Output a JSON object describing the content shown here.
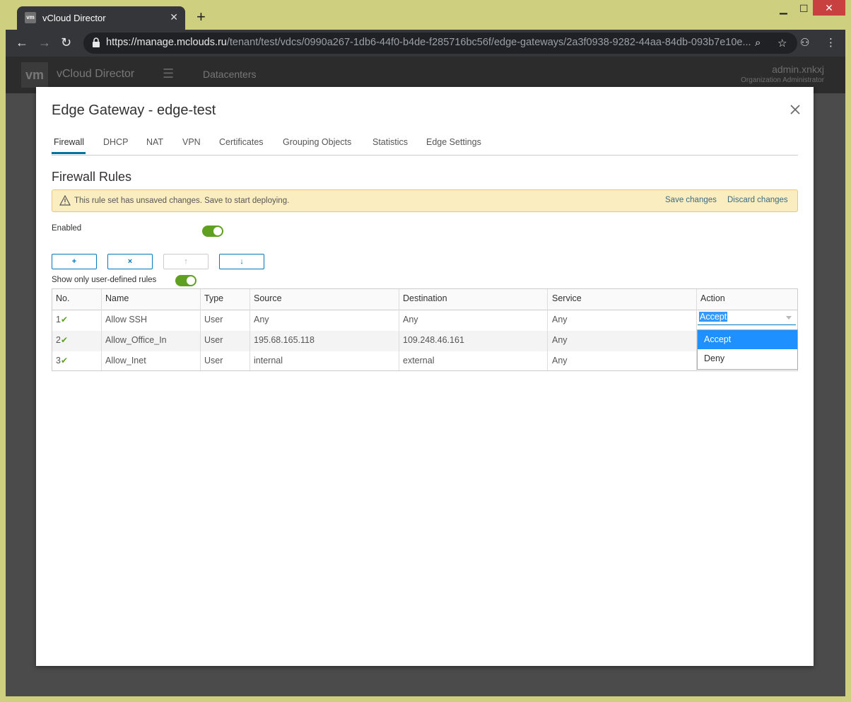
{
  "browser": {
    "tab_title": "vCloud Director",
    "favicon_text": "vm",
    "url_host": "https://manage.mclouds.ru",
    "url_path": "/tenant/test/vdcs/0990a267-1db6-44f0-b4de-f285716bc56f/edge-gateways/2a3f0938-9282-44aa-84db-093b7e10e..."
  },
  "app": {
    "logo": "vm",
    "name": "vCloud Director",
    "nav": "Datacenters",
    "user": "admin.xnkxj",
    "role": "Organization Administrator"
  },
  "modal": {
    "title": "Edge Gateway - edge-test",
    "tabs": [
      "Firewall",
      "DHCP",
      "NAT",
      "VPN",
      "Certificates",
      "Grouping Objects",
      "Statistics",
      "Edge Settings"
    ],
    "active_tab": "Firewall",
    "section_title": "Firewall Rules",
    "alert": {
      "text": "This rule set has unsaved changes. Save to start deploying.",
      "save": "Save changes",
      "discard": "Discard changes"
    },
    "enabled_label": "Enabled",
    "enabled": true,
    "buttons": {
      "add": "+",
      "remove": "×",
      "up": "↑",
      "down": "↓"
    },
    "user_defined_label": "Show only user-defined rules",
    "user_defined": true,
    "columns": [
      "No.",
      "Name",
      "Type",
      "Source",
      "Destination",
      "Service",
      "Action"
    ],
    "rows": [
      {
        "no": "1",
        "name": "Allow SSH",
        "type": "User",
        "source": "Any",
        "destination": "Any",
        "service": "Any",
        "action": "Accept"
      },
      {
        "no": "2",
        "name": "Allow_Office_In",
        "type": "User",
        "source": "195.68.165.118",
        "destination": "109.248.46.161",
        "service": "Any",
        "action": ""
      },
      {
        "no": "3",
        "name": "Allow_Inet",
        "type": "User",
        "source": "internal",
        "destination": "external",
        "service": "Any",
        "action": ""
      }
    ],
    "action_options": [
      "Accept",
      "Deny"
    ],
    "action_selected": "Accept"
  },
  "colors": {
    "accent": "#0079b8",
    "toggle_on": "#5fa021",
    "alert_bg": "#faeec0",
    "option_highlight": "#1e90ff"
  }
}
